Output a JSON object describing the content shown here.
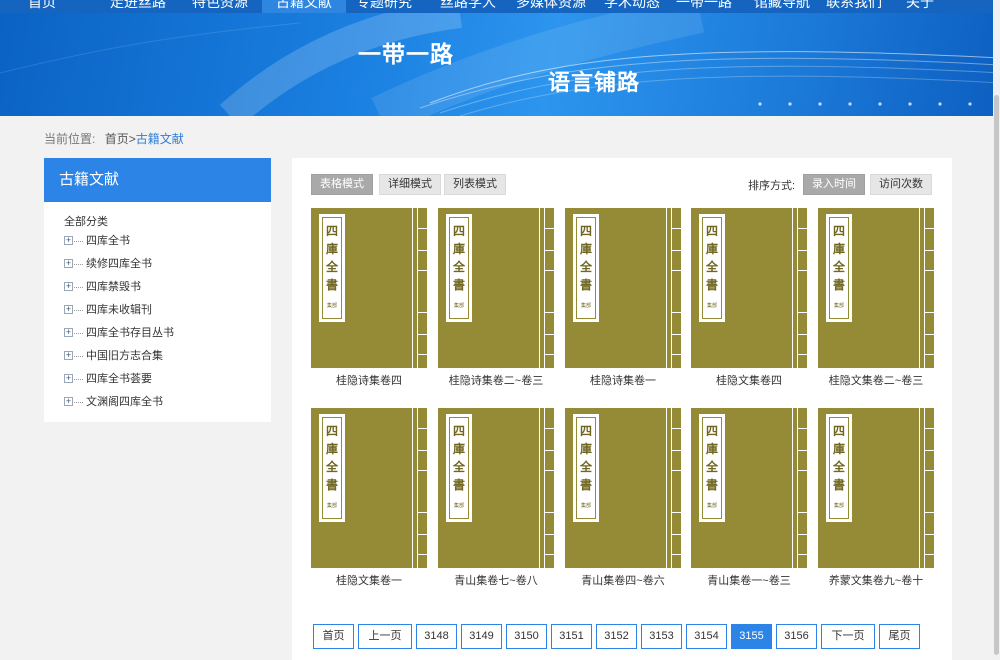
{
  "topnav": {
    "items": [
      "首页",
      "走进丝路",
      "特色资源",
      "古籍文献",
      "专题研究",
      "丝路学人",
      "多媒体资源",
      "学术动态",
      "一带一路",
      "馆藏导航",
      "联系我们",
      "关于"
    ]
  },
  "banner": {
    "line1": "一带一路",
    "line2": "语言铺路"
  },
  "breadcrumb": {
    "prefix": "当前位置:",
    "home": "首页>",
    "current": "古籍文献"
  },
  "sidebar": {
    "heading": "古籍文献",
    "root": "全部分类",
    "items": [
      {
        "label": "四库全书"
      },
      {
        "label": "续修四库全书"
      },
      {
        "label": "四库禁毁书"
      },
      {
        "label": "四库未收辑刊"
      },
      {
        "label": "四库全书存目丛书"
      },
      {
        "label": "中国旧方志合集"
      },
      {
        "label": "四库全书荟要"
      },
      {
        "label": "文渊阁四库全书"
      }
    ]
  },
  "toolbar": {
    "modes": [
      "表格模式",
      "详细模式",
      "列表模式"
    ],
    "active_mode": "表格模式",
    "sort_label": "排序方式:",
    "sorts": [
      "录入时间",
      "访问次数"
    ],
    "active_sort": "录入时间"
  },
  "cover": {
    "chars": [
      "四",
      "庫",
      "全",
      "書"
    ],
    "sub": "集部",
    "color": "#958a35"
  },
  "books": [
    {
      "title": "桂隐诗集卷四"
    },
    {
      "title": "桂隐诗集卷二~卷三"
    },
    {
      "title": "桂隐诗集卷一"
    },
    {
      "title": "桂隐文集卷四"
    },
    {
      "title": "桂隐文集卷二~卷三"
    },
    {
      "title": "桂隐文集卷一"
    },
    {
      "title": "青山集卷七~卷八"
    },
    {
      "title": "青山集卷四~卷六"
    },
    {
      "title": "青山集卷一~卷三"
    },
    {
      "title": "养蒙文集卷九~卷十"
    }
  ],
  "pagination": {
    "first": "首页",
    "prev": "上一页",
    "pages": [
      "3148",
      "3149",
      "3150",
      "3151",
      "3152",
      "3153",
      "3154",
      "3155",
      "3156"
    ],
    "current": "3155",
    "next": "下一页",
    "last": "尾页"
  },
  "colors": {
    "accent": "#2b84e6",
    "nav": "#1565c0",
    "cover": "#958a35"
  }
}
